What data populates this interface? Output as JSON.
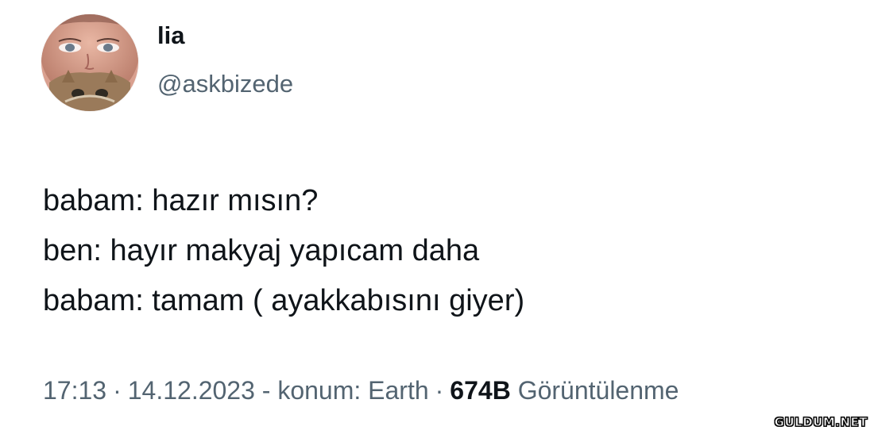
{
  "author": {
    "display_name": "lia",
    "handle": "@askbizede",
    "avatar_icon": "profile-photo"
  },
  "tweet": {
    "lines": [
      "babam: hazır mısın?",
      "ben: hayır makyaj yapıcam daha",
      "babam: tamam ( ayakkabısını giyer)"
    ]
  },
  "meta": {
    "time": "17:13",
    "date_location": "14.12.2023 - konum: Earth",
    "views_count": "674B",
    "views_label": "Görüntülenme",
    "separator": "·"
  },
  "watermark": "GULDUM.NET",
  "colors": {
    "text": "#0f1419",
    "secondary_text": "#536471",
    "background": "#ffffff"
  }
}
